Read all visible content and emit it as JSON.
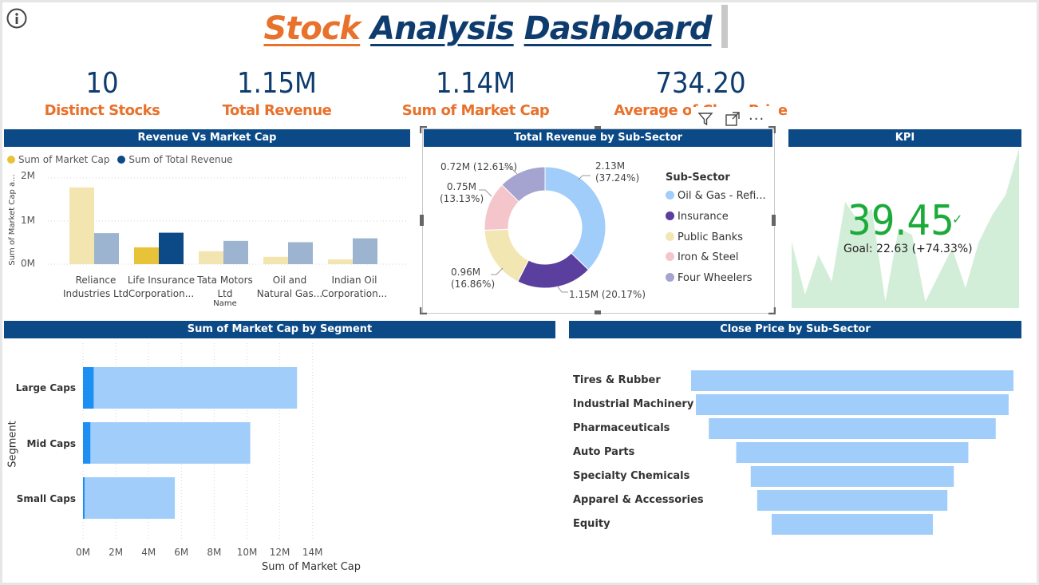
{
  "header": {
    "title_part1": "Stock",
    "title_part2": "Analysis",
    "title_part3": "Dashboard",
    "colors": {
      "orange": "#e8712b",
      "navy": "#0e3c6e"
    }
  },
  "cards": [
    {
      "value": "10",
      "label": "Distinct Stocks"
    },
    {
      "value": "1.15M",
      "label": "Total Revenue"
    },
    {
      "value": "1.14M",
      "label": "Sum of Market Cap"
    },
    {
      "value": "734.20",
      "label": "Average of Close Price"
    }
  ],
  "visual_toolbar": {
    "icons": [
      "filter-icon",
      "focus-mode-icon",
      "more-options-icon"
    ],
    "more_label": "..."
  },
  "revenue_vs_mcap": {
    "title": "Revenue Vs Market Cap",
    "legend": [
      "Sum of Market Cap",
      "Sum of Total Revenue"
    ],
    "y_axis_title": "Sum of Market Cap a...",
    "x_axis_title": "Name",
    "y_ticks": [
      "2M",
      "1M",
      "0M"
    ],
    "categories": [
      [
        "Reliance",
        "Industries Ltd"
      ],
      [
        "Life Insurance",
        "Corporation..."
      ],
      [
        "Tata Motors",
        "Ltd"
      ],
      [
        "Oil and",
        "Natural Gas..."
      ],
      [
        "Indian Oil",
        "Corporation..."
      ]
    ]
  },
  "donut": {
    "title": "Total Revenue by Sub-Sector",
    "legend_title": "Sub-Sector",
    "items": [
      {
        "name": "Oil & Gas - Refi...",
        "value_label": "2.13M",
        "pct_label": "(37.24%)"
      },
      {
        "name": "Insurance",
        "value_label": "1.15M (20.17%)",
        "pct_label": ""
      },
      {
        "name": "Public Banks",
        "value_label": "0.96M",
        "pct_label": "(16.86%)"
      },
      {
        "name": "Iron & Steel",
        "value_label": "0.75M",
        "pct_label": "(13.13%)"
      },
      {
        "name": "Four Wheelers",
        "value_label": "0.72M (12.61%)",
        "pct_label": ""
      }
    ]
  },
  "kpi": {
    "title": "KPI",
    "value": "39.45",
    "check": "✓",
    "goal": "Goal: 22.63 (+74.33%)"
  },
  "segment": {
    "title": "Sum of Market Cap by Segment",
    "y_axis_title": "Segment",
    "x_axis_title": "Sum of Market Cap",
    "x_ticks": [
      "0M",
      "2M",
      "4M",
      "6M",
      "8M",
      "10M",
      "12M",
      "14M"
    ],
    "categories": [
      "Large Caps",
      "Mid Caps",
      "Small Caps"
    ]
  },
  "funnel": {
    "title": "Close Price by Sub-Sector",
    "categories": [
      "Tires & Rubber",
      "Industrial Machinery",
      "Pharmaceuticals",
      "Auto Parts",
      "Specialty Chemicals",
      "Apparel & Accessories",
      "Equity"
    ]
  },
  "chart_data": [
    {
      "type": "bar",
      "title": "Revenue Vs Market Cap",
      "xlabel": "Name",
      "ylabel": "Sum of Market Cap a...",
      "ylim": [
        0,
        2000000
      ],
      "categories": [
        "Reliance Industries Ltd",
        "Life Insurance Corporation...",
        "Tata Motors Ltd",
        "Oil and Natural Gas...",
        "Indian Oil Corporation..."
      ],
      "series": [
        {
          "name": "Sum of Market Cap",
          "color": "#e8c33a",
          "highlight_index": 1,
          "values": [
            1780000,
            390000,
            300000,
            170000,
            110000
          ]
        },
        {
          "name": "Sum of Total Revenue",
          "color": "#0c4a87",
          "highlight_index": 1,
          "values": [
            720000,
            730000,
            540000,
            510000,
            600000
          ]
        }
      ]
    },
    {
      "type": "pie",
      "title": "Total Revenue by Sub-Sector",
      "categories": [
        "Oil & Gas - Refi...",
        "Insurance",
        "Public Banks",
        "Iron & Steel",
        "Four Wheelers"
      ],
      "values": [
        2130000,
        1150000,
        960000,
        750000,
        720000
      ],
      "percents": [
        37.24,
        20.17,
        16.86,
        13.13,
        12.61
      ],
      "colors": [
        "#a0cdfa",
        "#5b3f9e",
        "#f2e6b3",
        "#f4c6cb",
        "#a5a3cf"
      ]
    },
    {
      "type": "area",
      "title": "KPI",
      "values": [
        10,
        2,
        8,
        4,
        16,
        13,
        15,
        1,
        12,
        11,
        1,
        5,
        9,
        3,
        10,
        14,
        17,
        24
      ],
      "color": "#d3eed8",
      "value": 39.45,
      "goal": 22.63
    },
    {
      "type": "bar",
      "orientation": "horizontal",
      "title": "Sum of Market Cap by Segment",
      "xlabel": "Sum of Market Cap",
      "ylabel": "Segment",
      "xlim": [
        0,
        14000000
      ],
      "categories": [
        "Large Caps",
        "Mid Caps",
        "Small Caps"
      ],
      "series": [
        {
          "name": "highlighted",
          "color": "#1e8ff2",
          "values": [
            650000,
            450000,
            50000
          ]
        },
        {
          "name": "total",
          "color": "#a0cdfa",
          "values": [
            13050000,
            10200000,
            5600000
          ]
        }
      ]
    },
    {
      "type": "bar",
      "subtype": "funnel",
      "title": "Close Price by Sub-Sector",
      "categories": [
        "Tires & Rubber",
        "Industrial Machinery",
        "Pharmaceuticals",
        "Auto Parts",
        "Specialty Chemicals",
        "Apparel & Accessories",
        "Equity"
      ],
      "values": [
        100,
        97,
        89,
        72,
        63,
        59,
        50
      ],
      "color": "#a0cdfa"
    }
  ]
}
